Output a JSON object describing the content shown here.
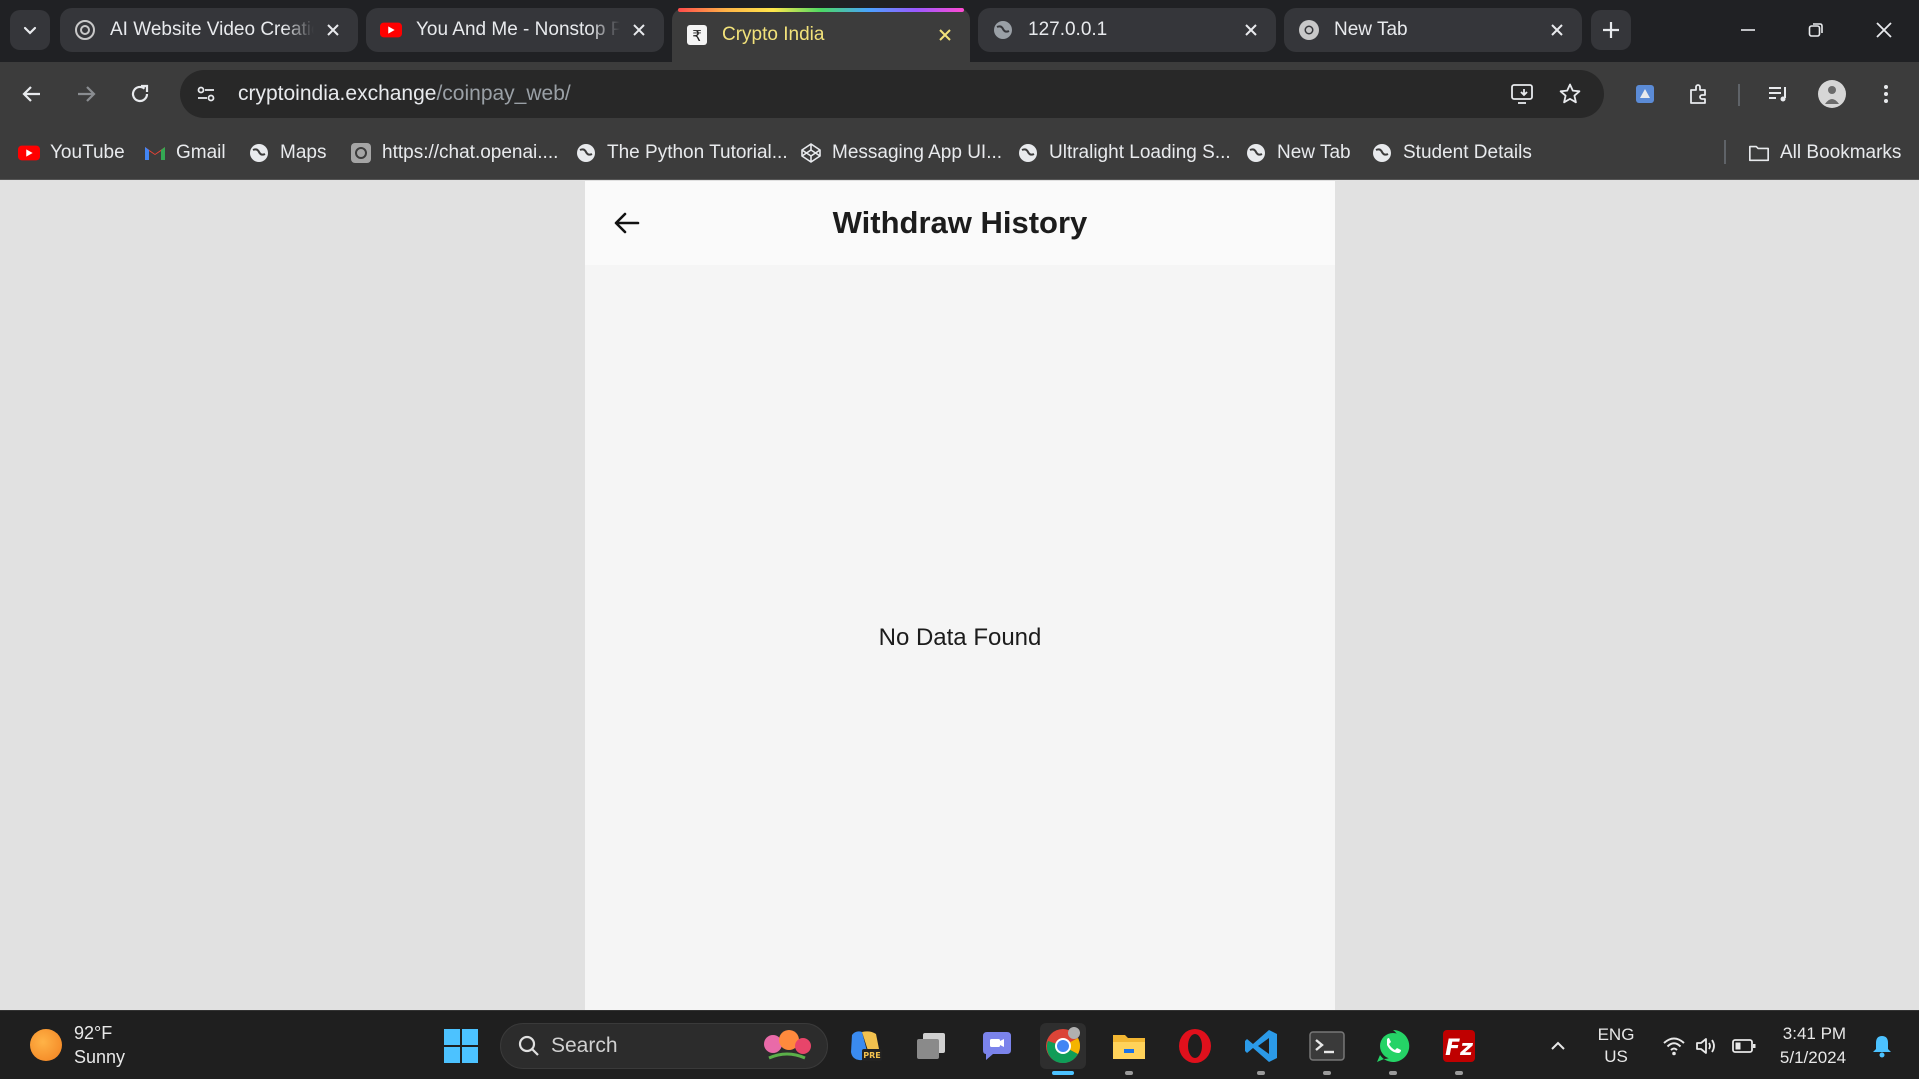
{
  "browser": {
    "tabs": [
      {
        "title": "AI Website Video Creatio",
        "favicon": "openai-icon",
        "active": false
      },
      {
        "title": "You And Me - Nonstop P",
        "favicon": "youtube-icon",
        "active": false
      },
      {
        "title": "Crypto India",
        "favicon": "rupee-icon",
        "active": true
      },
      {
        "title": "127.0.0.1",
        "favicon": "globe-icon",
        "active": false
      },
      {
        "title": "New Tab",
        "favicon": "chrome-icon",
        "active": false
      }
    ],
    "address_bar": {
      "host": "cryptoindia.exchange",
      "path": "/coinpay_web/"
    },
    "bookmarks": [
      {
        "label": "YouTube",
        "icon": "youtube-icon"
      },
      {
        "label": "Gmail",
        "icon": "gmail-icon"
      },
      {
        "label": "Maps",
        "icon": "globe-icon"
      },
      {
        "label": "https://chat.openai....",
        "icon": "openai-icon"
      },
      {
        "label": "The Python Tutorial...",
        "icon": "globe-icon"
      },
      {
        "label": "Messaging App UI...",
        "icon": "codepen-icon"
      },
      {
        "label": "Ultralight Loading S...",
        "icon": "globe-icon"
      },
      {
        "label": "New Tab",
        "icon": "globe-icon"
      },
      {
        "label": "Student Details",
        "icon": "globe-icon"
      }
    ],
    "all_bookmarks_label": "All Bookmarks"
  },
  "page": {
    "title": "Withdraw History",
    "empty_message": "No Data Found"
  },
  "taskbar": {
    "weather": {
      "temp": "92°F",
      "condition": "Sunny"
    },
    "search_label": "Search",
    "language": {
      "line1": "ENG",
      "line2": "US"
    },
    "time": "3:41 PM",
    "date": "5/1/2024",
    "colors": {
      "accent": "#4cc2ff"
    }
  },
  "colors": {
    "active_tab_text": "#f2e27a",
    "page_background": "#e1e1e1",
    "app_background": "#f5f5f5"
  }
}
